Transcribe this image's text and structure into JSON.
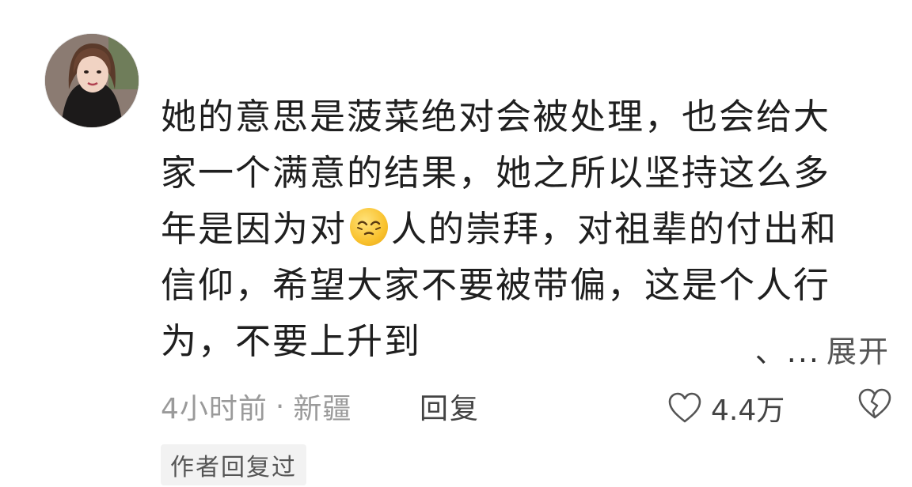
{
  "comment": {
    "lines": [
      "她的意思是菠菜绝对会被处理，也会给大",
      "家一个满意的结果，她之所以坚持这么多",
      "年是因为对",
      "人的崇拜，对祖辈的付出和",
      "信仰，希望大家不要被带偏，这是个人行",
      "为，不要上升到"
    ],
    "inline_emoji": "squint-smile-emoji"
  },
  "expand": {
    "ellipsis": "、...",
    "label": "展开"
  },
  "meta": {
    "time": "4小时前",
    "separator": "·",
    "location": "新疆",
    "reply_label": "回复"
  },
  "like": {
    "count": "4.4万",
    "icon": "heart-outline-icon"
  },
  "dislike": {
    "icon": "broken-heart-icon"
  },
  "author_tag": "作者回复过",
  "colors": {
    "text": "#1f1f1f",
    "meta": "#9a9a9a",
    "tag_bg": "#f2f2f2"
  }
}
